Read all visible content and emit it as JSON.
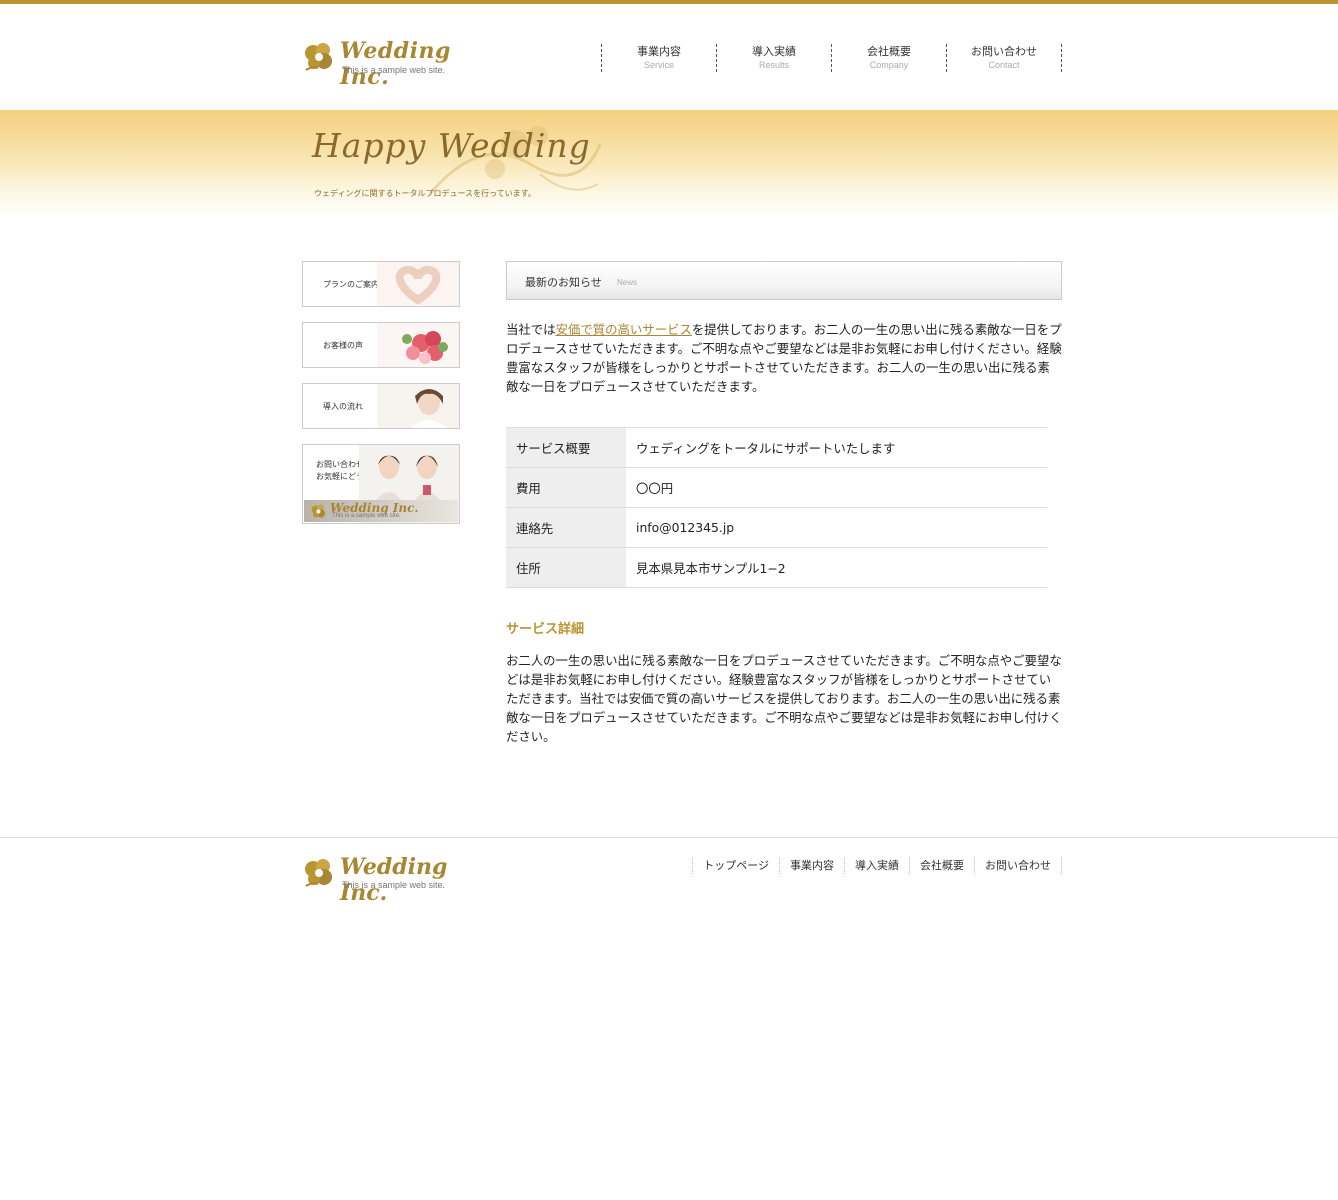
{
  "header": {
    "logo": {
      "brand": "Wedding Inc.",
      "tagline": "This is a sample web site."
    },
    "nav": [
      {
        "jp": "事業内容",
        "en": "Service"
      },
      {
        "jp": "導入実績",
        "en": "Results"
      },
      {
        "jp": "会社概要",
        "en": "Company"
      },
      {
        "jp": "お問い合わせ",
        "en": "Contact"
      }
    ]
  },
  "hero": {
    "title": "Happy Wedding",
    "subtitle": "ウェディングに関するトータルプロデュースを行っています。"
  },
  "sidebar": {
    "banners": [
      {
        "label": "プランのご案内",
        "icon": "heart-hands-photo"
      },
      {
        "label": "お客様の声",
        "icon": "bouquet-photo"
      },
      {
        "label": "導入の流れ",
        "icon": "bride-photo"
      }
    ],
    "contact": {
      "label_line1": "お問い合わせは",
      "label_line2": "お気軽にどうぞ",
      "brand": "Wedding Inc.",
      "tagline": "This is a sample web site."
    }
  },
  "news": {
    "heading_jp": "最新のお知らせ",
    "heading_en": "News",
    "intro_before": "当社では",
    "intro_link": "安価で質の高いサービス",
    "intro_after": "を提供しております。お二人の一生の思い出に残る素敵な一日をプロデュースさせていただきます。ご不明な点やご要望などは是非お気軽にお申し付けください。経験豊富なスタッフが皆様をしっかりとサポートさせていただきます。お二人の一生の思い出に残る素敵な一日をプロデュースさせていただきます。"
  },
  "info_table": [
    {
      "label": "サービス概要",
      "value": "ウェディングをトータルにサポートいたします"
    },
    {
      "label": "費用",
      "value": "〇〇円"
    },
    {
      "label": "連絡先",
      "value": "info@012345.jp"
    },
    {
      "label": "住所",
      "value": "見本県見本市サンプル1−2"
    }
  ],
  "detail": {
    "title": "サービス詳細",
    "body": "お二人の一生の思い出に残る素敵な一日をプロデュースさせていただきます。ご不明な点やご要望などは是非お気軽にお申し付けください。経験豊富なスタッフが皆様をしっかりとサポートさせていただきます。当社では安価で質の高いサービスを提供しております。お二人の一生の思い出に残る素敵な一日をプロデュースさせていただきます。ご不明な点やご要望などは是非お気軽にお申し付けください。"
  },
  "footer": {
    "logo": {
      "brand": "Wedding Inc.",
      "tagline": "This is a sample web site."
    },
    "nav": [
      "トップページ",
      "事業内容",
      "導入実績",
      "会社概要",
      "お問い合わせ"
    ]
  },
  "colors": {
    "accent": "#b8952f",
    "hero_top": "#f4d07f",
    "text": "#222222"
  }
}
